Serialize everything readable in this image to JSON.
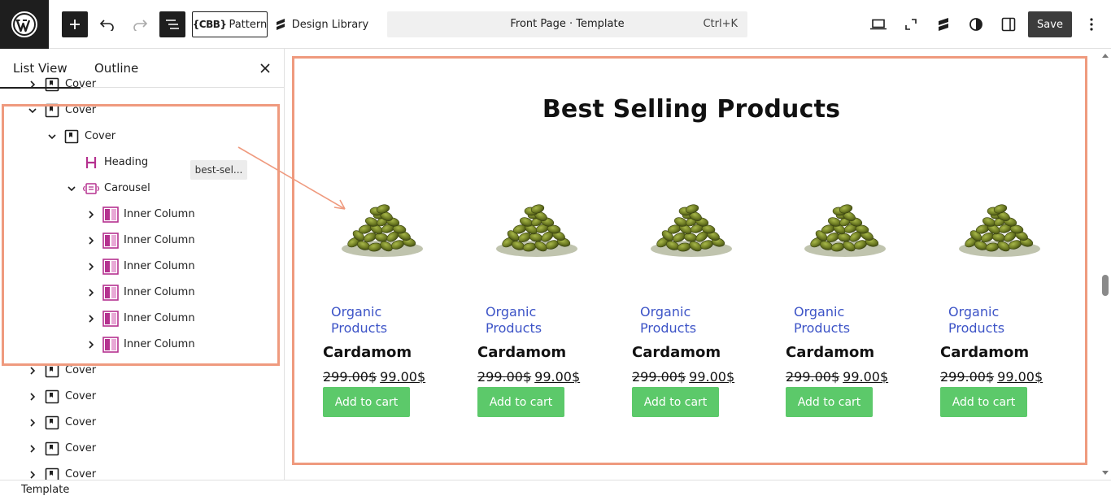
{
  "toolbar": {
    "pattern_label": "Pattern",
    "pattern_brand": "{CBB}",
    "design_library_label": "Design Library",
    "command": {
      "title": "Front Page · Template",
      "shortcut": "Ctrl+K"
    },
    "save_label": "Save"
  },
  "sidebar": {
    "tabs": [
      "List View",
      "Outline"
    ],
    "anchor_badge": "best-sel...",
    "tree": [
      {
        "label": "Cover",
        "icon": "cover-icon",
        "expanded": false
      },
      {
        "label": "Cover",
        "icon": "cover-icon",
        "expanded": true
      },
      {
        "label": "Cover",
        "icon": "cover-icon",
        "expanded": true
      },
      {
        "label": "Heading",
        "icon": "heading-icon"
      },
      {
        "label": "Carousel",
        "icon": "carousel-icon",
        "expanded": true
      },
      {
        "label": "Inner Column",
        "icon": "column-icon",
        "expanded": false
      },
      {
        "label": "Inner Column",
        "icon": "column-icon",
        "expanded": false
      },
      {
        "label": "Inner Column",
        "icon": "column-icon",
        "expanded": false
      },
      {
        "label": "Inner Column",
        "icon": "column-icon",
        "expanded": false
      },
      {
        "label": "Inner Column",
        "icon": "column-icon",
        "expanded": false
      },
      {
        "label": "Inner Column",
        "icon": "column-icon",
        "expanded": false
      },
      {
        "label": "Cover",
        "icon": "cover-icon",
        "expanded": false
      },
      {
        "label": "Cover",
        "icon": "cover-icon",
        "expanded": false
      },
      {
        "label": "Cover",
        "icon": "cover-icon",
        "expanded": false
      },
      {
        "label": "Cover",
        "icon": "cover-icon",
        "expanded": false
      },
      {
        "label": "Cover",
        "icon": "cover-icon",
        "expanded": false
      }
    ]
  },
  "canvas": {
    "section_title": "Best Selling Products",
    "products": [
      {
        "category": "Organic Products",
        "name": "Cardamom",
        "old_price": "299.00$",
        "price": "99.00$",
        "button": "Add to cart"
      },
      {
        "category": "Organic Products",
        "name": "Cardamom",
        "old_price": "299.00$",
        "price": "99.00$",
        "button": "Add to cart"
      },
      {
        "category": "Organic Products",
        "name": "Cardamom",
        "old_price": "299.00$",
        "price": "99.00$",
        "button": "Add to cart"
      },
      {
        "category": "Organic Products",
        "name": "Cardamom",
        "old_price": "299.00$",
        "price": "99.00$",
        "button": "Add to cart"
      },
      {
        "category": "Organic Products",
        "name": "Cardamom",
        "old_price": "299.00$",
        "price": "99.00$",
        "button": "Add to cart"
      }
    ]
  },
  "footer": {
    "breadcrumb": "Template"
  },
  "colors": {
    "accent_highlight": "#ef9a7e",
    "add_to_cart": "#5cc96a",
    "category_link": "#3d54c7",
    "block_icon_purple": "#b5318f"
  }
}
